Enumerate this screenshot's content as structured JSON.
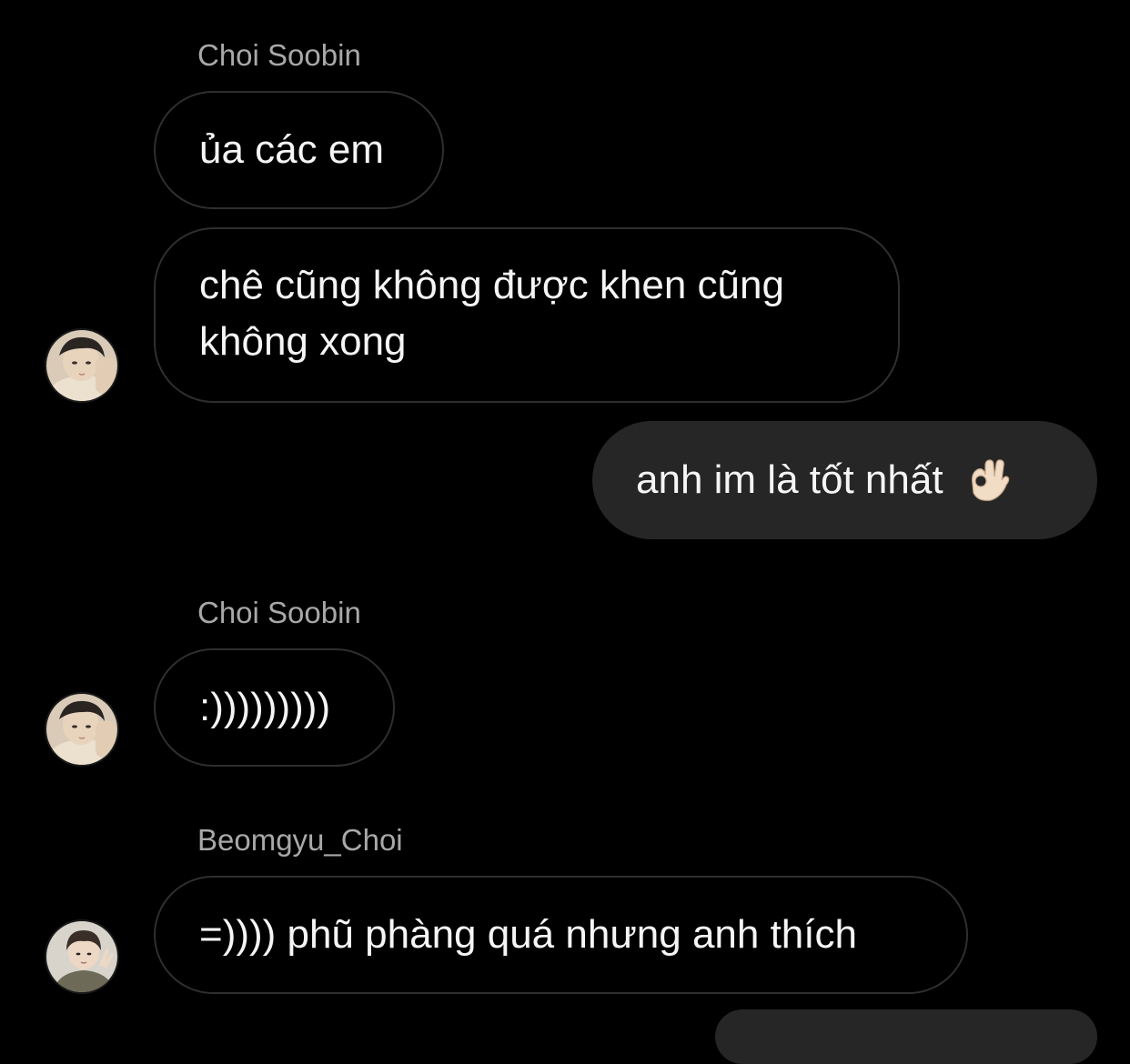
{
  "messages": [
    {
      "sender": "Choi Soobin",
      "text": "ủa các em"
    },
    {
      "text": "chê cũng không được khen cũng không xong"
    },
    {
      "outgoing": true,
      "text": "anh im là tốt nhất",
      "emoji": "ok-hand-emoji"
    },
    {
      "sender": "Choi Soobin",
      "text": ":)))))))))"
    },
    {
      "sender": "Beomgyu_Choi",
      "text": "=)))) phũ phàng quá nhưng anh thích"
    }
  ],
  "colors": {
    "background": "#000000",
    "sender_name": "#a8a8a8",
    "incoming_border": "#2f2f2f",
    "outgoing_bubble": "#262626",
    "text": "#f5f5f5"
  },
  "icons": {
    "avatar_soobin": "avatar-soobin",
    "avatar_beomgyu": "avatar-beomgyu"
  }
}
